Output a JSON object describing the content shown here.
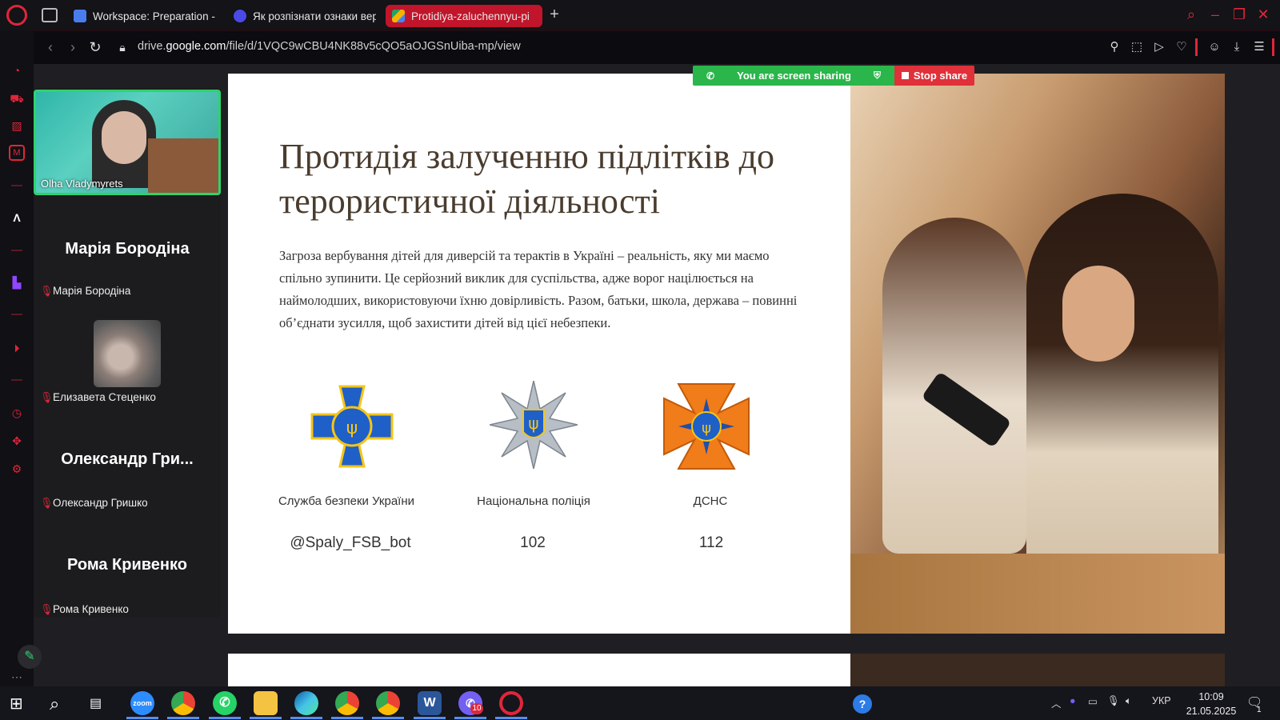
{
  "tabs": [
    {
      "label": "Workspace: Preparation -",
      "icon_color": "#4a7cf0"
    },
    {
      "label": "Як розпізнати ознаки вер",
      "icon_color": "#4a4ae8"
    },
    {
      "label": "Protidiya-zaluchennyu-pi",
      "icon_color": "#f4b400",
      "active": true
    }
  ],
  "address": {
    "prefix": "drive.",
    "domain": "google.com",
    "path": "/file/d/1VQC9wCBU4NK88v5cQO5aOJGSnUiba-mp/view"
  },
  "share_banner": {
    "text": "You are screen sharing",
    "stop_label": "Stop share"
  },
  "participants": {
    "video": {
      "name": "Olha Vladymyrets"
    },
    "list": [
      {
        "big": "Марія Бородіна",
        "name": "Марія Бородіна"
      },
      {
        "big": "",
        "name": "Елизавета Стеценко"
      },
      {
        "big": "Олександр Гри...",
        "name": "Олександр Гришко"
      },
      {
        "big": "Рома Кривенко",
        "name": "Рома Кривенко"
      }
    ]
  },
  "slide": {
    "title": "Протидія залученню підлітків до терористичної діяльності",
    "body": "Загроза вербування дітей для диверсій та терактів в Україні – реальність, яку ми маємо спільно зупинити. Це серйозний виклик для суспільства, адже ворог націлюється на наймолодших, використовуючи їхню довірливість. Разом, батьки, школа, держава – повинні об’єднати зусилля, щоб захистити дітей від цієї небезпеки.",
    "orgs": [
      {
        "label": "Служба безпеки України",
        "contact": "@Spaly_FSB_bot",
        "emblem": "sbu-emblem",
        "color": "#1f5fc8"
      },
      {
        "label": "Національна поліція",
        "contact": "102",
        "emblem": "police-emblem",
        "color": "#9aa0a8"
      },
      {
        "label": "ДСНС",
        "contact": "112",
        "emblem": "dsns-emblem",
        "color": "#f07c1a"
      }
    ]
  },
  "taskbar": {
    "apps": [
      "zoom",
      "chrome",
      "whatsapp",
      "explorer",
      "edge",
      "chrome-profile",
      "chrome-profile-2",
      "word",
      "viber",
      "opera"
    ],
    "viber_badge": "10",
    "lang": "УКР",
    "time": "10:09",
    "date": "21.05.2025",
    "notification_count": "1"
  },
  "colors": {
    "accent": "#e0263a",
    "share_green": "#2ab64a",
    "stop_red": "#e0303a"
  }
}
